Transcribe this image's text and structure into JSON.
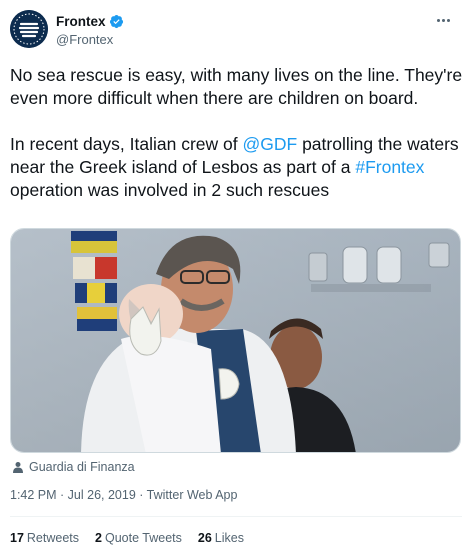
{
  "account": {
    "display_name": "Frontex",
    "handle": "@Frontex",
    "avatar_icon": "frontex-logo",
    "verified_icon": "verified-badge-icon"
  },
  "tweet": {
    "paragraph1": "No sea rescue is easy, with many lives on the line. They're even more difficult when there are children on board.",
    "p2_part1": "In recent days, Italian crew of ",
    "p2_mention": "@GDF",
    "p2_part2": " patrolling the waters near the Greek island of Lesbos as part of a ",
    "p2_hashtag": "#Frontex",
    "p2_part3": " operation was involved in 2 such rescues"
  },
  "media": {
    "credit": "Guardia di Finanza"
  },
  "meta": {
    "time_date": "1:42 PM · Jul 26, 2019",
    "separator": " · ",
    "source": "Twitter Web App"
  },
  "stats": {
    "retweets_count": "17",
    "retweets_label": "Retweets",
    "quotes_count": "2",
    "quotes_label": "Quote Tweets",
    "likes_count": "26",
    "likes_label": "Likes"
  },
  "colors": {
    "link": "#1d9bf0",
    "text": "#0f1419",
    "secondary": "#536471"
  }
}
